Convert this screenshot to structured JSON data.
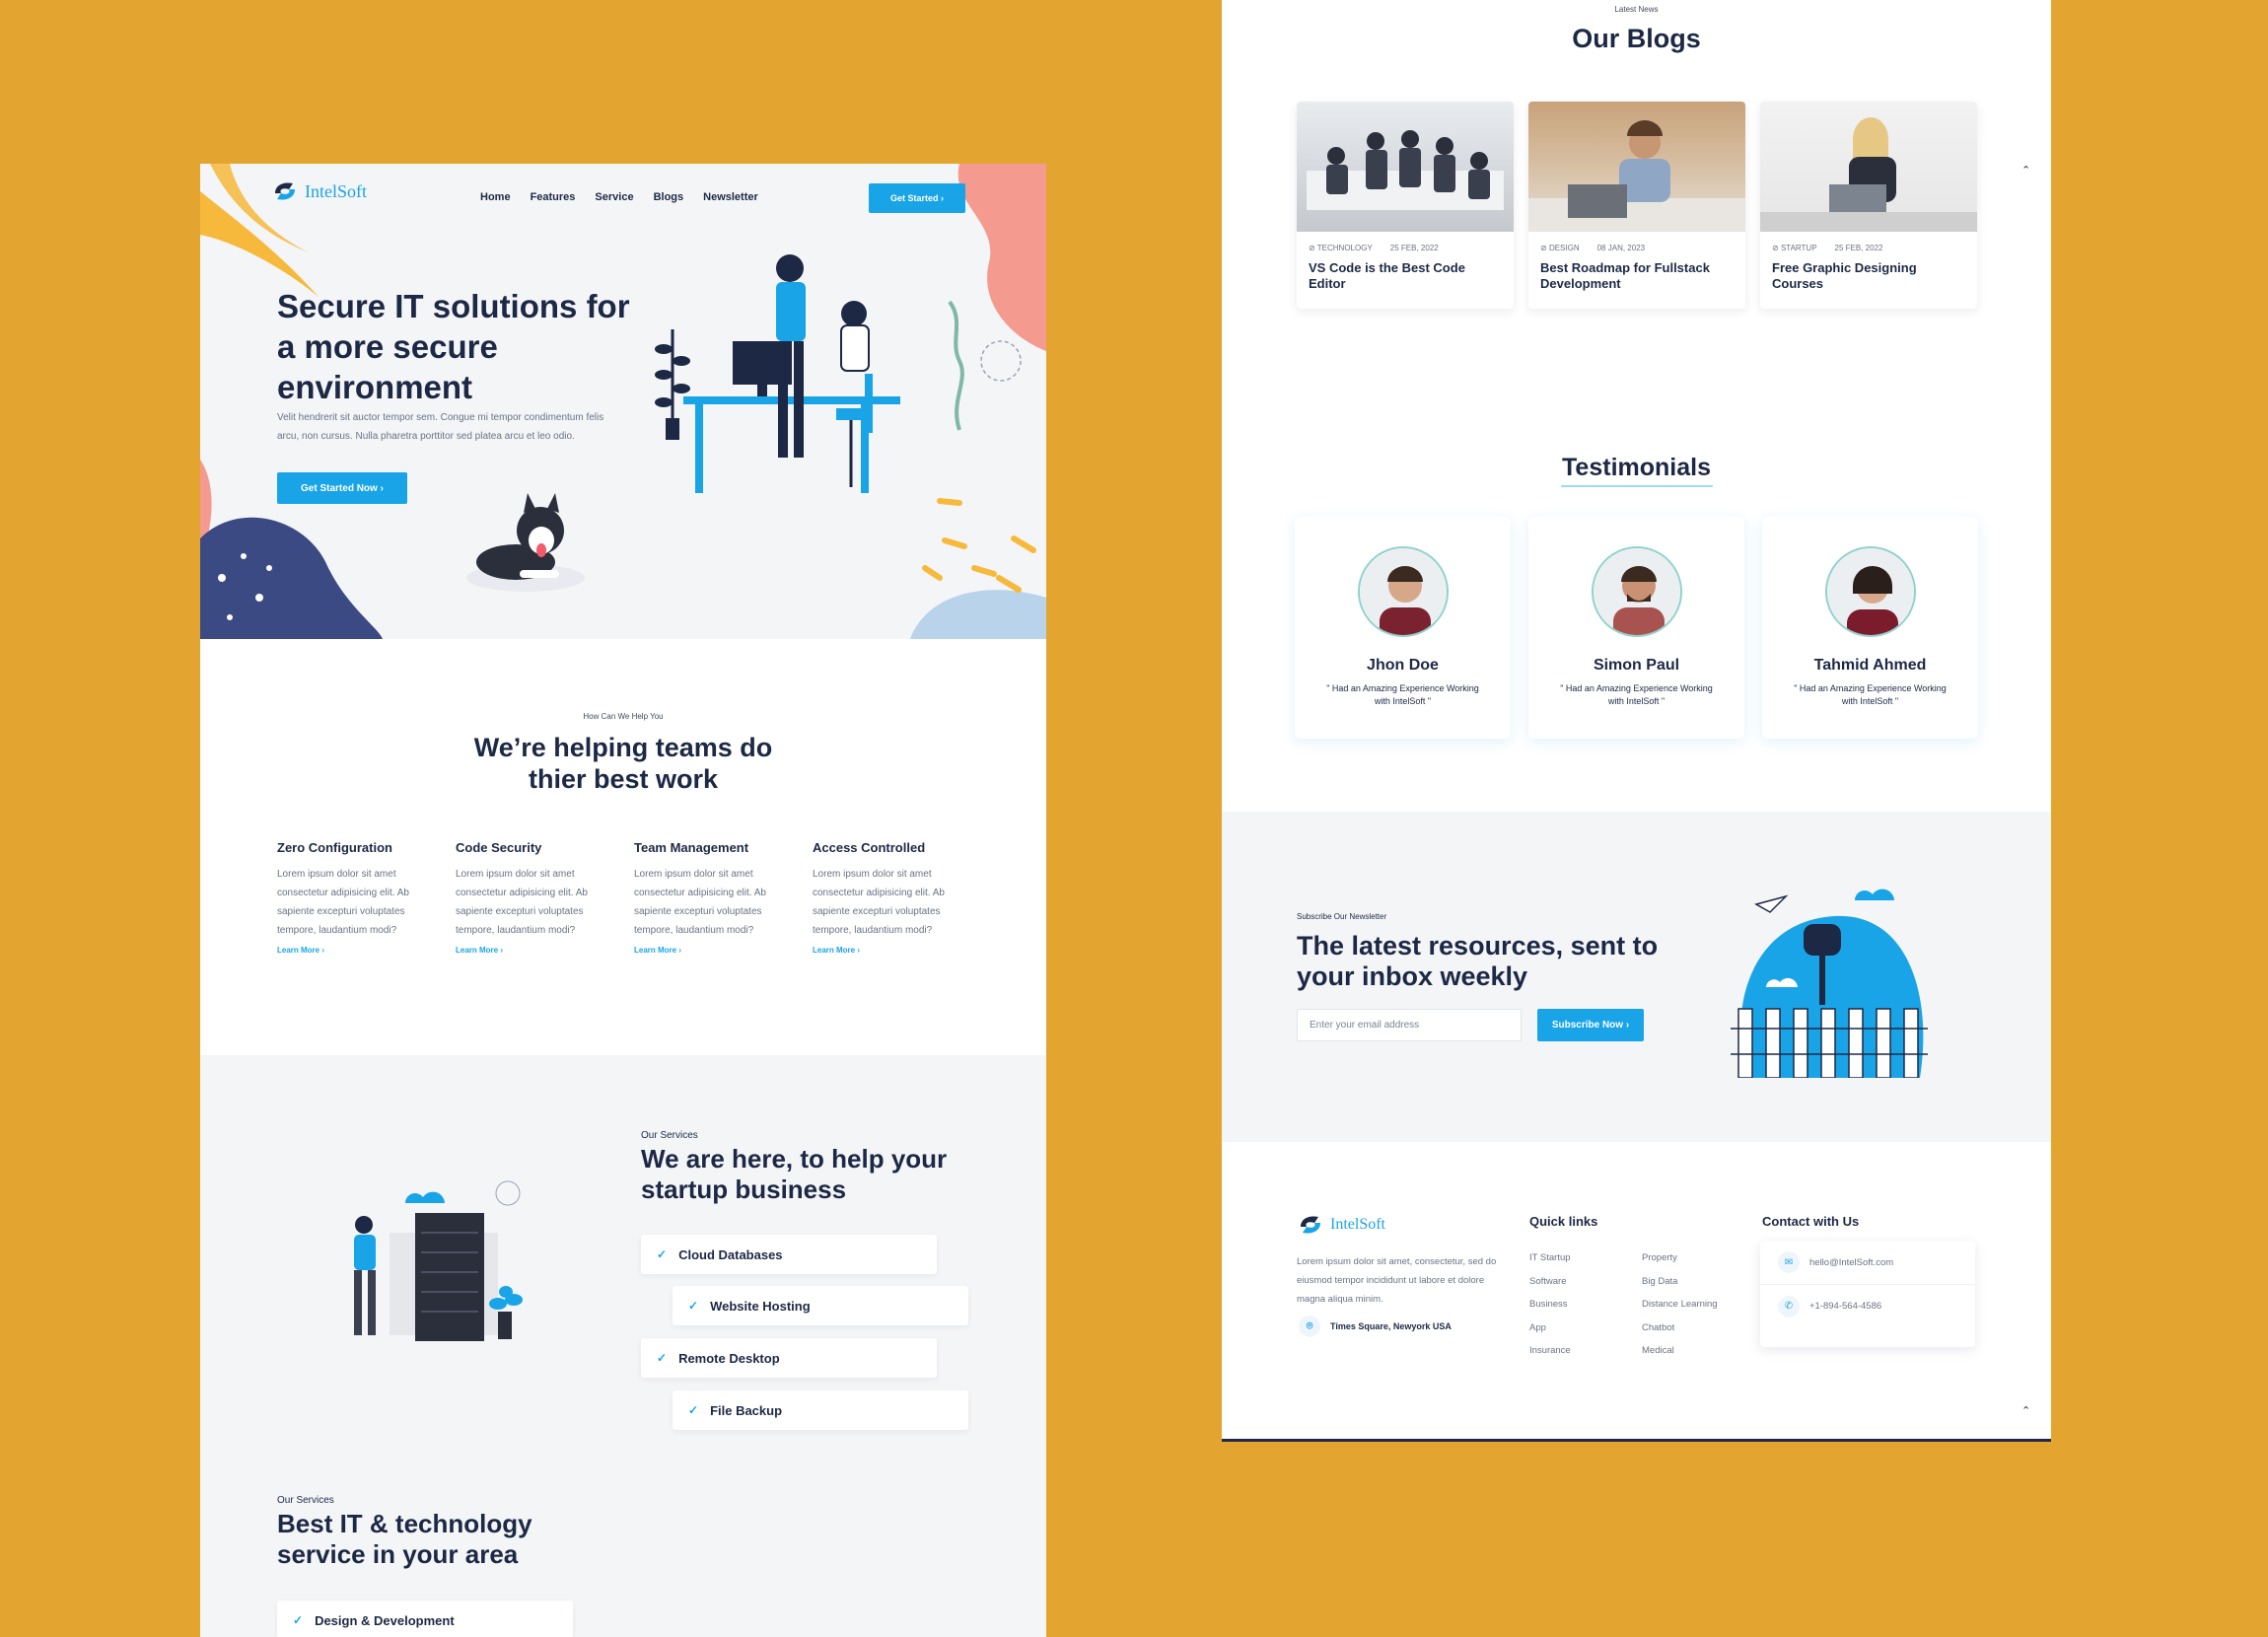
{
  "brand": {
    "name": "IntelSoft"
  },
  "nav": {
    "items": [
      "Home",
      "Features",
      "Service",
      "Blogs",
      "Newsletter"
    ],
    "cta": "Get Started"
  },
  "hero": {
    "title": "Secure IT solutions for a more secure environment",
    "lead": "Velit hendrerit sit auctor tempor sem. Congue mi tempor condimentum felis arcu, non cursus. Nulla pharetra porttitor sed platea arcu et leo odio.",
    "cta": "Get Started Now"
  },
  "help": {
    "eyebrow": "How Can We Help You",
    "title": "We’re helping teams do thier best work",
    "features": [
      {
        "title": "Zero Configuration",
        "text": "Lorem ipsum dolor sit amet consectetur adipisicing elit. Ab sapiente excepturi voluptates tempore, laudantium modi?",
        "link": "Learn More"
      },
      {
        "title": "Code Security",
        "text": "Lorem ipsum dolor sit amet consectetur adipisicing elit. Ab sapiente excepturi voluptates tempore, laudantium modi?",
        "link": "Learn More"
      },
      {
        "title": "Team Management",
        "text": "Lorem ipsum dolor sit amet consectetur adipisicing elit. Ab sapiente excepturi voluptates tempore, laudantium modi?",
        "link": "Learn More"
      },
      {
        "title": "Access Controlled",
        "text": "Lorem ipsum dolor sit amet consectetur adipisicing elit. Ab sapiente excepturi voluptates tempore, laudantium modi?",
        "link": "Learn More"
      }
    ]
  },
  "services": {
    "tag": "Our Services",
    "title": "We are here, to help your startup business",
    "items": [
      "Cloud Databases",
      "Website Hosting",
      "Remote Desktop",
      "File Backup"
    ],
    "tag2": "Our Services",
    "title2": "Best IT & technology service in your area",
    "items2": [
      "Design & Development"
    ]
  },
  "blogs": {
    "eyebrow": "Latest News",
    "title": "Our Blogs",
    "posts": [
      {
        "category": "TECHNOLOGY",
        "date": "25 FEB, 2022",
        "title": "VS Code is the Best Code Editor"
      },
      {
        "category": "DESIGN",
        "date": "08 JAN, 2023",
        "title": "Best Roadmap for Fullstack Development"
      },
      {
        "category": "STARTUP",
        "date": "25 FEB, 2022",
        "title": "Free Graphic Designing Courses"
      }
    ]
  },
  "testimonials": {
    "title": "Testimonials",
    "items": [
      {
        "name": "Jhon Doe",
        "quote": "\" Had an Amazing Experience Working with IntelSoft \""
      },
      {
        "name": "Simon Paul",
        "quote": "\" Had an Amazing Experience Working with IntelSoft \""
      },
      {
        "name": "Tahmid Ahmed",
        "quote": "\" Had an Amazing Experience Working with IntelSoft \""
      }
    ]
  },
  "newsletter": {
    "tag": "Subscribe Our Newsletter",
    "title": "The latest resources, sent to your inbox weekly",
    "placeholder": "Enter your email address",
    "cta": "Subscribe Now"
  },
  "footer": {
    "about": "Lorem ipsum dolor sit amet, consectetur, sed do eiusmod tempor incididunt ut labore et dolore magna aliqua minim.",
    "address": "Times Square, Newyork USA",
    "quick_title": "Quick links",
    "quick_col1": [
      "IT Startup",
      "Software",
      "Business",
      "App",
      "Insurance"
    ],
    "quick_col2": [
      "Property",
      "Big Data",
      "Distance Learning",
      "Chatbot",
      "Medical"
    ],
    "contact_title": "Contact with Us",
    "email": "hello@IntelSoft.com",
    "phone": "+1-894-564-4586"
  },
  "colors": {
    "accent": "#19a4e8",
    "navy": "#1d2845",
    "background": "#e3a52f"
  }
}
